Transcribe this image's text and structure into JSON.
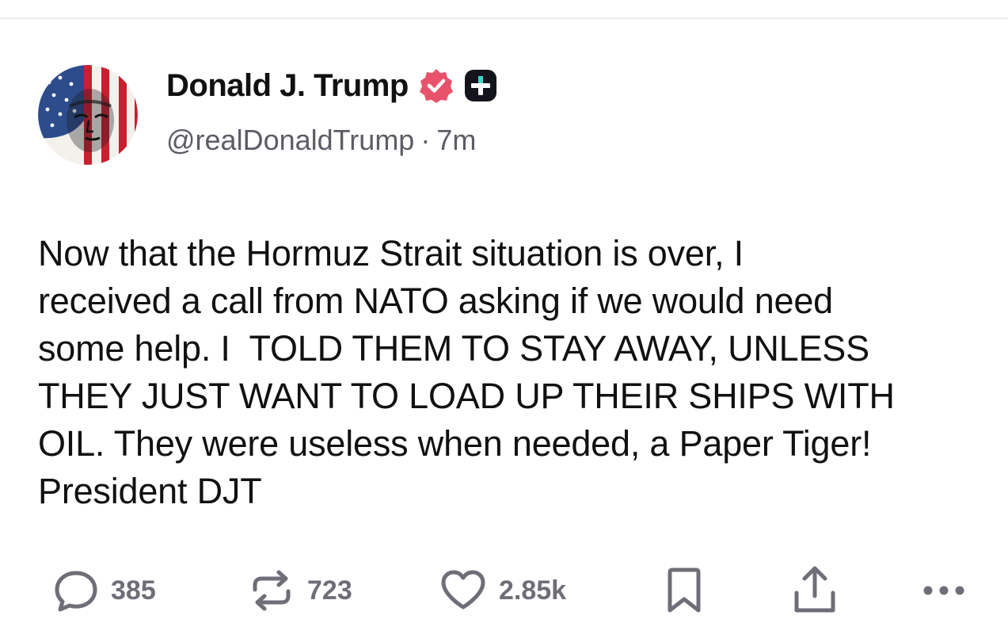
{
  "post": {
    "author": {
      "display_name": "Donald J. Trump",
      "handle": "@realDonaldTrump",
      "verified": true,
      "verified_icon": "verified-badge-icon",
      "plus_icon": "plus-badge-icon",
      "verified_color": "#e8536b"
    },
    "separator": "·",
    "timestamp": "7m",
    "body": "Now that the Hormuz Strait situation is over, I\nreceived a call from NATO asking if we would need\nsome help. I  TOLD THEM TO STAY AWAY, UNLESS\nTHEY JUST WANT TO LOAD UP THEIR SHIPS WITH\nOIL. They were useless when needed, a Paper Tiger!\nPresident DJT",
    "actions": {
      "replies": {
        "icon": "reply-icon",
        "count": "385"
      },
      "reposts": {
        "icon": "repost-icon",
        "count": "723"
      },
      "likes": {
        "icon": "heart-icon",
        "count": "2.85k"
      },
      "bookmark": {
        "icon": "bookmark-icon"
      },
      "share": {
        "icon": "share-icon"
      },
      "more": {
        "icon": "more-icon"
      }
    }
  }
}
